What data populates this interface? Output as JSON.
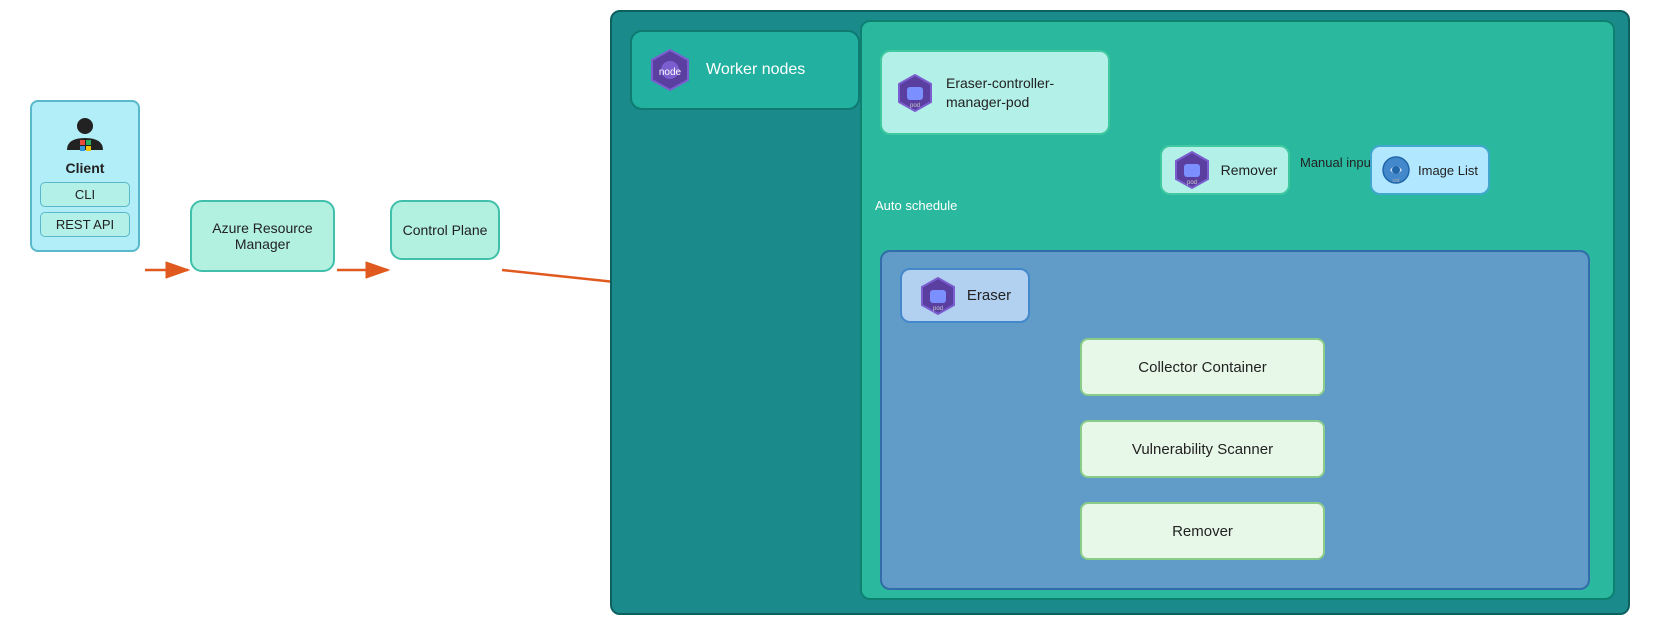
{
  "client": {
    "label": "Client",
    "cli_label": "CLI",
    "rest_label": "REST API"
  },
  "arm": {
    "label": "Azure Resource Manager"
  },
  "control_plane": {
    "label": "Control Plane"
  },
  "worker_nodes": {
    "label": "Worker nodes"
  },
  "eraser_controller": {
    "label": "Eraser-controller-manager-pod"
  },
  "remover_top": {
    "label": "Remover"
  },
  "image_list": {
    "label": "Image List"
  },
  "eraser_pod": {
    "label": "Eraser"
  },
  "collector_container": {
    "label": "Collector Container"
  },
  "vulnerability_scanner": {
    "label": "Vulnerability Scanner"
  },
  "remover_bottom": {
    "label": "Remover"
  },
  "auto_schedule": {
    "label": "Auto schedule"
  },
  "manual_input": {
    "label": "Manual input"
  },
  "colors": {
    "arrow_orange": "#e05a20",
    "arrow_blue_dark": "#2244aa"
  }
}
